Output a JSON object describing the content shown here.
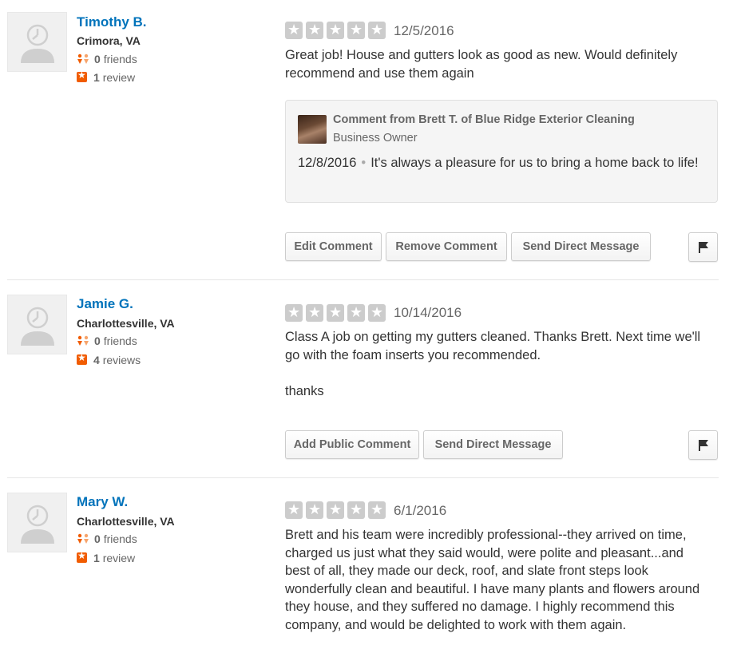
{
  "reviews": [
    {
      "user": {
        "name": "Timothy B.",
        "location": "Crimora, VA",
        "friends_count": "0",
        "friends_label": "friends",
        "reviews_count": "1",
        "reviews_label": "review"
      },
      "rating": 5,
      "date": "12/5/2016",
      "text": "Great job! House and gutters look as good as new. Would definitely recommend and use them again",
      "text2": "",
      "comment": {
        "from": "Comment from Brett T. of Blue Ridge Exterior Cleaning",
        "role": "Business Owner",
        "date": "12/8/2016",
        "text": "It's always a pleasure for us to bring a home back to life!"
      },
      "buttons": [
        "Edit Comment",
        "Remove Comment",
        "Send Direct Message"
      ]
    },
    {
      "user": {
        "name": "Jamie G.",
        "location": "Charlottesville, VA",
        "friends_count": "0",
        "friends_label": "friends",
        "reviews_count": "4",
        "reviews_label": "reviews"
      },
      "rating": 5,
      "date": "10/14/2016",
      "text": "Class A job on getting my gutters cleaned. Thanks Brett. Next time we'll go with the foam inserts you recommended.",
      "text2": "thanks",
      "buttons": [
        "Add Public Comment",
        "Send Direct Message"
      ]
    },
    {
      "user": {
        "name": "Mary W.",
        "location": "Charlottesville, VA",
        "friends_count": "0",
        "friends_label": "friends",
        "reviews_count": "1",
        "reviews_label": "review"
      },
      "rating": 5,
      "date": "6/1/2016",
      "text": "Brett and his team were incredibly professional--they arrived on time, charged us just what they said would, were polite and pleasant...and best of all, they made our deck, roof, and slate front steps look wonderfully clean and beautiful.  I have many plants and flowers around they house, and they suffered no damage.  I highly recommend this company, and would be delighted to work with them again.",
      "text2": ""
    }
  ],
  "icons": {
    "friends": "friends-icon",
    "reviews": "review-star-icon",
    "flag": "flag-icon"
  },
  "colors": {
    "link": "#0073bb",
    "star_empty": "#cccccc",
    "review_badge": "#f15c00"
  }
}
